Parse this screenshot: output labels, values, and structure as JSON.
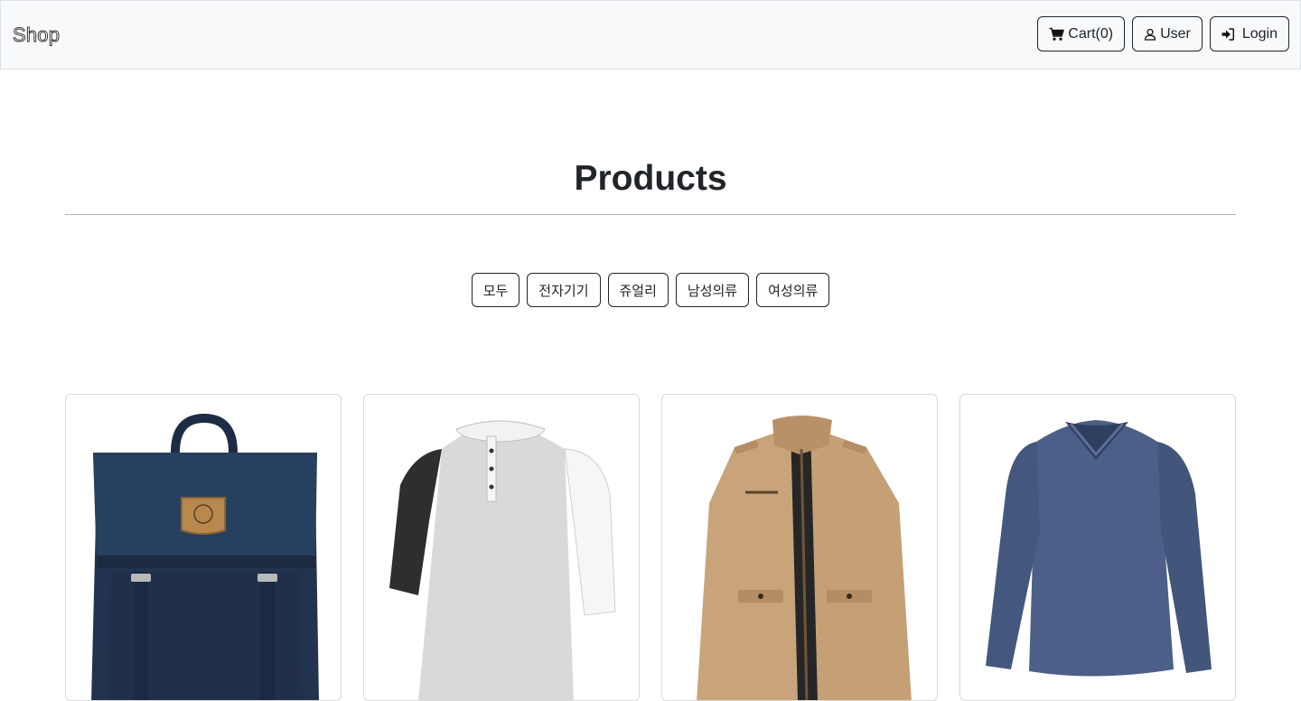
{
  "navbar": {
    "brand": "Shop",
    "cart_label": "Cart(0)",
    "user_label": "User",
    "login_label": "Login"
  },
  "page_title": "Products",
  "filters": [
    "모두",
    "전자기기",
    "쥬얼리",
    "남성의류",
    "여성의류"
  ],
  "products": [
    {
      "icon": "backpack-image",
      "color": "#243652"
    },
    {
      "icon": "raglan-shirt-image",
      "color": "#d8d8d8"
    },
    {
      "icon": "khaki-jacket-image",
      "color": "#c8a67c"
    },
    {
      "icon": "blue-longsleeve-image",
      "color": "#4a5f87"
    }
  ]
}
